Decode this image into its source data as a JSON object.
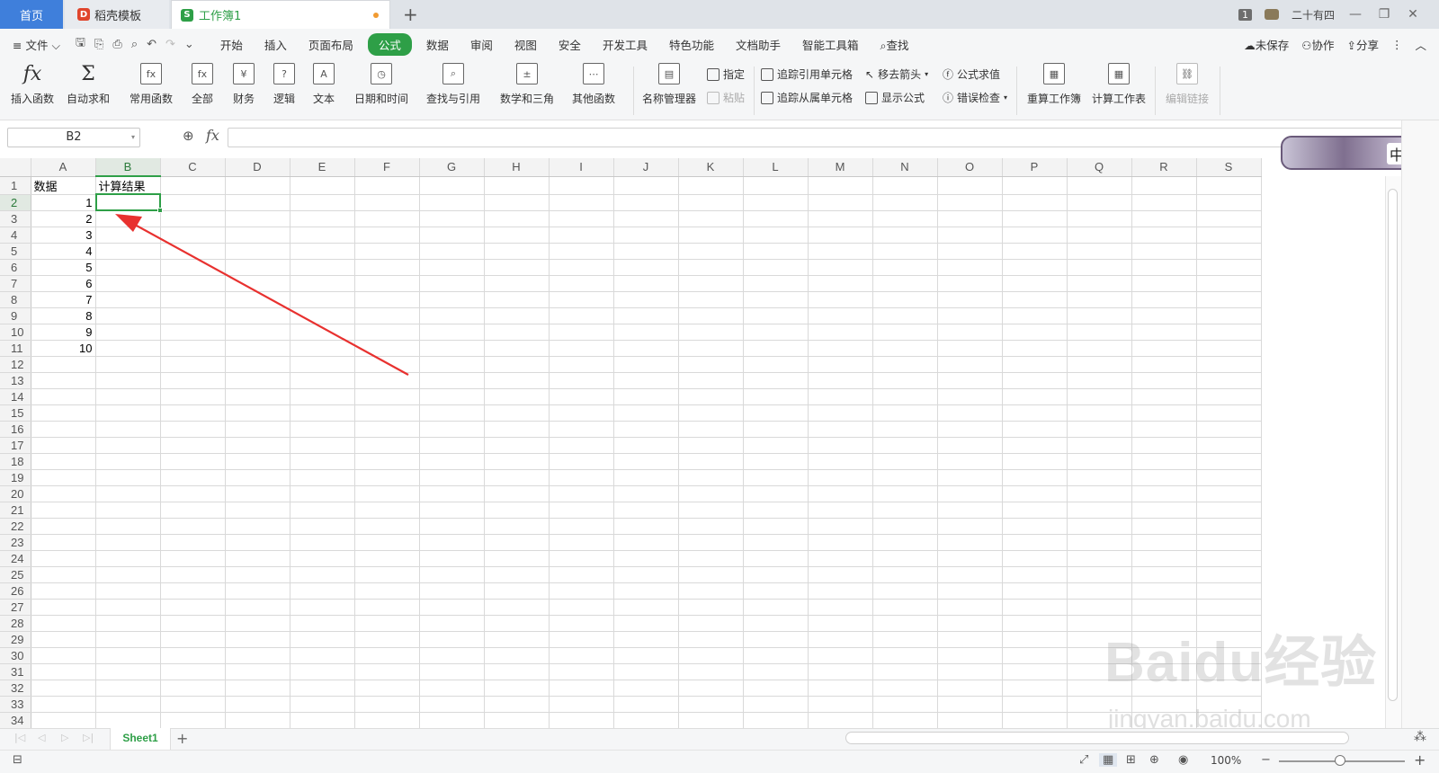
{
  "titlebar": {
    "tabs": [
      {
        "label": "首页"
      },
      {
        "label": "稻壳模板"
      },
      {
        "label": "工作簿1"
      }
    ],
    "badge": "1",
    "user": "二十有四"
  },
  "menu": {
    "file": "文件",
    "items": [
      "开始",
      "插入",
      "页面布局",
      "公式",
      "数据",
      "审阅",
      "视图",
      "安全",
      "开发工具",
      "特色功能",
      "文档助手",
      "智能工具箱"
    ],
    "active": "公式",
    "search": "查找",
    "unsaved": "未保存",
    "collab": "协作",
    "share": "分享"
  },
  "ribbon": {
    "insert_fn": "插入函数",
    "autosum": "自动求和",
    "common": "常用函数",
    "all": "全部",
    "finance": "财务",
    "logic": "逻辑",
    "text": "文本",
    "datetime": "日期和时间",
    "lookup": "查找与引用",
    "math": "数学和三角",
    "other": "其他函数",
    "name_mgr": "名称管理器",
    "assign": "指定",
    "paste": "粘贴",
    "trace_prec": "追踪引用单元格",
    "trace_dep": "追踪从属单元格",
    "remove_arrows": "移去箭头",
    "show_formula": "显示公式",
    "eval_formula": "公式求值",
    "error_check": "错误检查",
    "recalc_book": "重算工作簿",
    "calc_sheet": "计算工作表",
    "edit_links": "编辑链接"
  },
  "formula_bar": {
    "name_box": "B2",
    "fx": "fx",
    "value": ""
  },
  "grid": {
    "columns": [
      "A",
      "B",
      "C",
      "D",
      "E",
      "F",
      "G",
      "H",
      "I",
      "J",
      "K",
      "L",
      "M",
      "N",
      "O",
      "P",
      "Q",
      "R",
      "S"
    ],
    "rows": [
      [
        "数据",
        "计算结果"
      ],
      [
        "1",
        ""
      ],
      [
        "2",
        ""
      ],
      [
        "3",
        ""
      ],
      [
        "4",
        ""
      ],
      [
        "5",
        ""
      ],
      [
        "6",
        ""
      ],
      [
        "7",
        ""
      ],
      [
        "8",
        ""
      ],
      [
        "9",
        ""
      ],
      [
        "10",
        ""
      ]
    ],
    "row_count": 34,
    "selected_cell": "B2"
  },
  "sheets": [
    "Sheet1"
  ],
  "status": {
    "zoom": "100%"
  },
  "ime": "中",
  "watermark": {
    "logo": "Baidu经验",
    "url": "jingyan.baidu.com"
  },
  "colors": {
    "accent": "#2e9f47",
    "arrow": "#e8312f",
    "tab_home": "#3f7fdb"
  }
}
